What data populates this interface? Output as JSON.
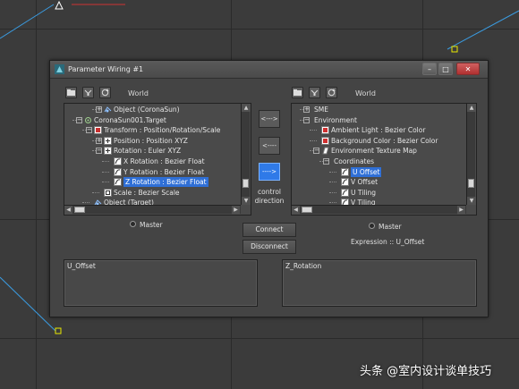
{
  "window": {
    "title": "Parameter Wiring #1"
  },
  "left_panel": {
    "world_label": "World",
    "rows": [
      {
        "label": "Object (CoronaSun)",
        "indent": 3,
        "expander": "+",
        "icon": "object"
      },
      {
        "label": "CoronaSun001.Target",
        "indent": 1,
        "expander": "-",
        "icon": "target"
      },
      {
        "label": "Transform : Position/Rotation/Scale",
        "indent": 2,
        "expander": "-",
        "icon": "transform"
      },
      {
        "label": "Position : Position XYZ",
        "indent": 3,
        "expander": "+",
        "icon": "controller"
      },
      {
        "label": "Rotation : Euler XYZ",
        "indent": 3,
        "expander": "-",
        "icon": "controller"
      },
      {
        "label": "X Rotation : Bezier Float",
        "indent": 4,
        "expander": "",
        "icon": "float"
      },
      {
        "label": "Y Rotation : Bezier Float",
        "indent": 4,
        "expander": "",
        "icon": "float"
      },
      {
        "label": "Z Rotation : Bezier Float",
        "indent": 4,
        "expander": "",
        "icon": "float",
        "selected": true
      },
      {
        "label": "Scale : Bezier Scale",
        "indent": 3,
        "expander": "",
        "icon": "scale"
      },
      {
        "label": "Object (Target)",
        "indent": 2,
        "expander": "",
        "icon": "object"
      }
    ],
    "master_label": "Master"
  },
  "right_panel": {
    "world_label": "World",
    "rows": [
      {
        "label": "SME",
        "indent": 1,
        "expander": "+",
        "icon": ""
      },
      {
        "label": "Environment",
        "indent": 1,
        "expander": "-",
        "icon": ""
      },
      {
        "label": "Ambient Light : Bezier Color",
        "indent": 2,
        "expander": "",
        "icon": "color"
      },
      {
        "label": "Background Color : Bezier Color",
        "indent": 2,
        "expander": "",
        "icon": "color"
      },
      {
        "label": "Environment Texture Map",
        "indent": 2,
        "expander": "-",
        "icon": "map"
      },
      {
        "label": "Coordinates",
        "indent": 3,
        "expander": "-",
        "icon": ""
      },
      {
        "label": "U Offset",
        "indent": 4,
        "expander": "",
        "icon": "float",
        "selected": true
      },
      {
        "label": "V Offset",
        "indent": 4,
        "expander": "",
        "icon": "float"
      },
      {
        "label": "U Tiling",
        "indent": 4,
        "expander": "",
        "icon": "float"
      },
      {
        "label": "V Tiling",
        "indent": 4,
        "expander": "",
        "icon": "float"
      }
    ],
    "master_label": "Master",
    "expression_label": "Expression :: U_Offset"
  },
  "direction": {
    "both_label": "<--->",
    "left_label": "<----",
    "right_label": "---->",
    "control_direction_label": "control direction",
    "active": "right"
  },
  "actions": {
    "connect_label": "Connect",
    "disconnect_label": "Disconnect"
  },
  "expressions": {
    "left_text": "U_Offset",
    "right_text": "Z_Rotation"
  },
  "watermark": {
    "text": "头条 @室内设计谈单技巧"
  },
  "colors": {
    "selection": "#2f6fd6",
    "active_button": "#2f7ae8",
    "viewport_line": "#3a9be0",
    "viewport_marker": "#e8e800"
  }
}
